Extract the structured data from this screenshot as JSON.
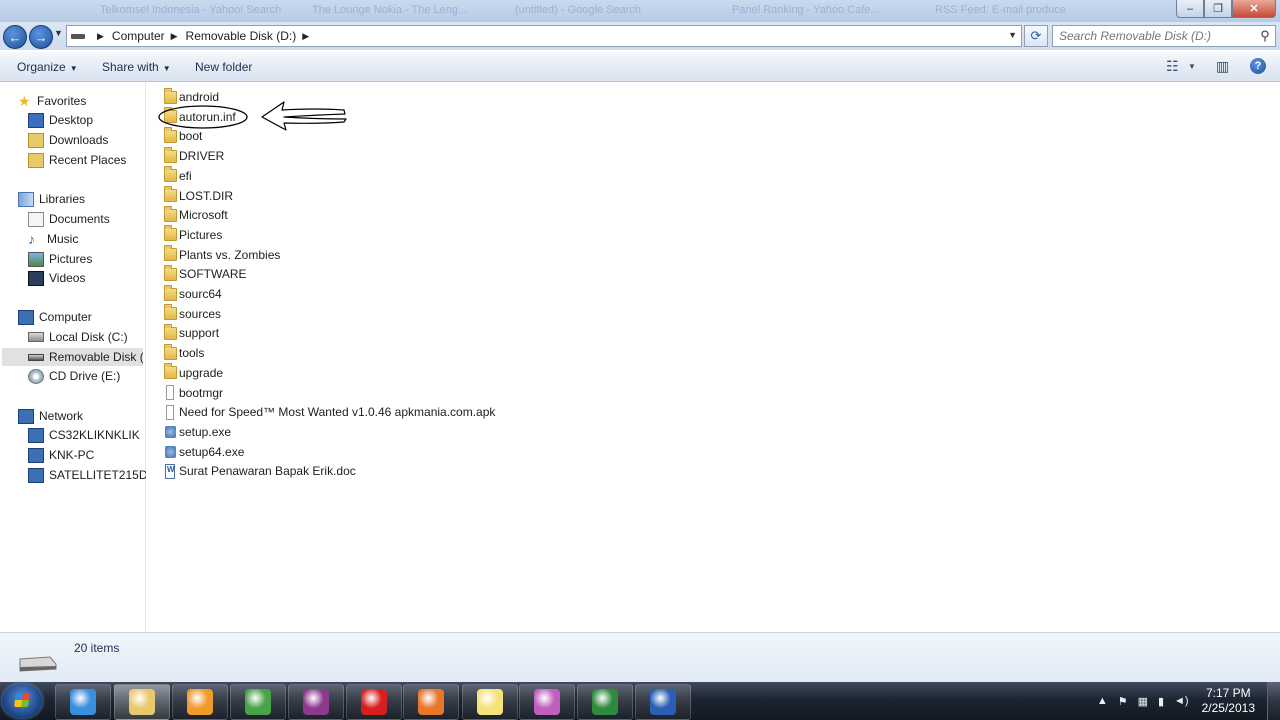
{
  "ghost_tabs": [
    "Telkomsel Indonesia - Yahoo! Search",
    "The Lounge Nokia - The Leng...",
    "(untitled) - Google Search",
    "Panel Ranking - Yahoo Cafe...",
    "RSS Feed: E-mail produce"
  ],
  "address": {
    "crumbs": [
      "Computer",
      "Removable Disk (D:)"
    ],
    "search_placeholder": "Search Removable Disk (D:)"
  },
  "command_bar": {
    "organize": "Organize",
    "share_with": "Share with",
    "new_folder": "New folder"
  },
  "nav": {
    "favorites": "Favorites",
    "favorites_items": [
      "Desktop",
      "Downloads",
      "Recent Places"
    ],
    "libraries": "Libraries",
    "libraries_items": [
      "Documents",
      "Music",
      "Pictures",
      "Videos"
    ],
    "computer": "Computer",
    "computer_items": [
      "Local Disk (C:)",
      "Removable Disk (D:)",
      "CD Drive (E:)"
    ],
    "selected": "Removable Disk (D:)",
    "network": "Network",
    "network_items": [
      "CS32KLIKNKLIK",
      "KNK-PC",
      "SATELLITET215D"
    ]
  },
  "files": [
    {
      "name": "android",
      "type": "folder"
    },
    {
      "name": "autorun.inf",
      "type": "folder",
      "annotated": true
    },
    {
      "name": "boot",
      "type": "folder"
    },
    {
      "name": "DRIVER",
      "type": "folder"
    },
    {
      "name": "efi",
      "type": "folder"
    },
    {
      "name": "LOST.DIR",
      "type": "folder"
    },
    {
      "name": "Microsoft",
      "type": "folder"
    },
    {
      "name": "Pictures",
      "type": "folder"
    },
    {
      "name": "Plants vs. Zombies",
      "type": "folder"
    },
    {
      "name": "SOFTWARE",
      "type": "folder"
    },
    {
      "name": "sourc64",
      "type": "folder"
    },
    {
      "name": "sources",
      "type": "folder"
    },
    {
      "name": "support",
      "type": "folder"
    },
    {
      "name": "tools",
      "type": "folder"
    },
    {
      "name": "upgrade",
      "type": "folder"
    },
    {
      "name": "bootmgr",
      "type": "file"
    },
    {
      "name": "Need for Speed™ Most Wanted v1.0.46 apkmania.com.apk",
      "type": "file"
    },
    {
      "name": "setup.exe",
      "type": "exe"
    },
    {
      "name": "setup64.exe",
      "type": "exe"
    },
    {
      "name": "Surat Penawaran Bapak Erik.doc",
      "type": "doc"
    }
  ],
  "status": {
    "item_count": "20 items"
  },
  "taskbar": {
    "apps": [
      {
        "name": "internet-explorer",
        "color": "#3b8fe0"
      },
      {
        "name": "windows-explorer",
        "color": "#e9c96a",
        "active": true
      },
      {
        "name": "media-player",
        "color": "#f09a2c"
      },
      {
        "name": "chrome",
        "color": "#4aa34a"
      },
      {
        "name": "winrar",
        "color": "#8b3a8f"
      },
      {
        "name": "opera",
        "color": "#d61f1f"
      },
      {
        "name": "firefox",
        "color": "#e8762b"
      },
      {
        "name": "sticky-notes",
        "color": "#f4e27a"
      },
      {
        "name": "messenger",
        "color": "#c05fc0"
      },
      {
        "name": "excel",
        "color": "#2e8b3d"
      },
      {
        "name": "word",
        "color": "#2b5fb5"
      }
    ],
    "time": "7:17 PM",
    "date": "2/25/2013"
  },
  "colors": {
    "selected_nav_bg": "#e1e1e1",
    "annotation_ink": "#000000"
  }
}
